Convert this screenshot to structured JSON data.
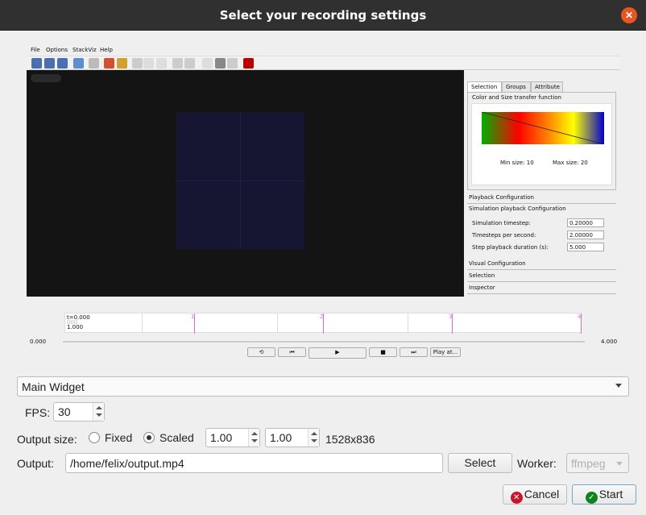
{
  "dialog": {
    "title": "Select your recording settings"
  },
  "preview": {
    "menu": [
      "File",
      "Options",
      "StackViz",
      "Help"
    ],
    "tabs": [
      "Selection",
      "Groups",
      "Attribute"
    ],
    "transfer_title": "Color and Size transfer function",
    "min_size": "Min size: 10",
    "max_size": "Max size: 20",
    "accordion": {
      "playback": "Playback Configuration",
      "simulation": "Simulation playback Configuration",
      "visual": "Visual Configuration",
      "selection": "Selection",
      "inspector": "Inspector"
    },
    "params": [
      {
        "label": "Simulation timestep:",
        "value": "0.20000"
      },
      {
        "label": "Timesteps per second:",
        "value": "2.00000"
      },
      {
        "label": "Step playback duration (s):",
        "value": "5.000"
      }
    ],
    "timeline": {
      "t_label": "t=0.000",
      "grey": "000",
      "val": "1.000",
      "ticks": [
        "1",
        "2",
        "3",
        "4"
      ]
    },
    "scrub_start": "0.000",
    "scrub_end": "4.000",
    "controls": {
      "loop": "⟲",
      "prev": "⏮",
      "play": "▶",
      "stop": "■",
      "next": "⏭",
      "playat": "Play at..."
    }
  },
  "widget_select": {
    "value": "Main Widget"
  },
  "fps": {
    "label": "FPS:",
    "value": "30"
  },
  "output_size": {
    "label": "Output size:",
    "fixed_label": "Fixed",
    "scaled_label": "Scaled",
    "selected": "Scaled",
    "scale_x": "1.00",
    "scale_y": "1.00",
    "resolution": "1528x836"
  },
  "output": {
    "label": "Output:",
    "path": "/home/felix/output.mp4",
    "select_label": "Select"
  },
  "worker": {
    "label": "Worker:",
    "value": "ffmpeg"
  },
  "actions": {
    "cancel": "Cancel",
    "start": "Start"
  },
  "colors": {
    "accent": "#e95420",
    "cancel": "#c7162b",
    "start": "#0e8420"
  }
}
